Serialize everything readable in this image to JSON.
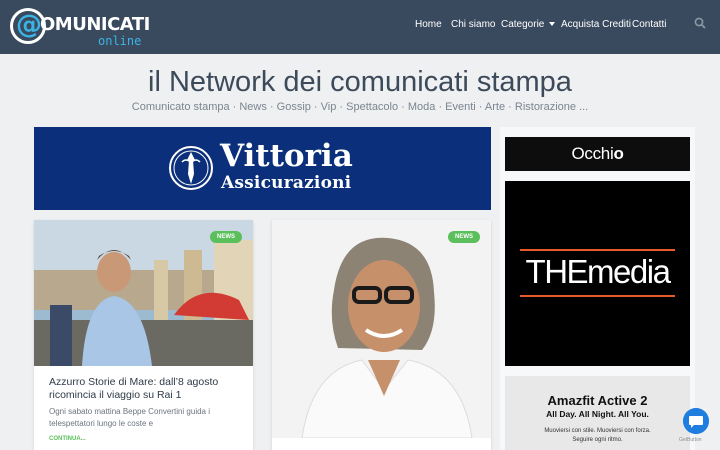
{
  "header": {
    "logo_at": "@",
    "logo_text": "OMUNICATI",
    "logo_sub": "online",
    "nav": [
      "Home",
      "Chi siamo",
      "Categorie",
      "Acquista Crediti",
      "Contatti"
    ]
  },
  "site": {
    "title": "il Network dei comunicati stampa",
    "subtitle": "Comunicato stampa · News · Gossip · Vip · Spettacolo · Moda · Eventi · Arte · Ristorazione ..."
  },
  "banner": {
    "title": "Vittoria",
    "subtitle": "Assicurazioni"
  },
  "cards": [
    {
      "badge": "NEWS",
      "title": "Azzurro Storie di Mare: dall’8 agosto ricomincia il viaggio su Rai 1",
      "excerpt": "Ogni sabato mattina Beppe Convertini guida i telespettatori lungo le coste e",
      "more": "CONTINUA..."
    },
    {
      "badge": "NEWS"
    }
  ],
  "sidebar": {
    "occhio_a": "Occhi",
    "occhio_b": "o",
    "themedia": "THEmedia",
    "amazfit_title": "Amazfit Active 2",
    "amazfit_tag": "All Day. All Night. All You.",
    "amazfit_desc_1": "Muoviersi con stile. Muoviersi con forza.",
    "amazfit_desc_2": "Seguire ogni ritmo."
  },
  "chat": {
    "label": "GetButton"
  },
  "colors": {
    "header_bg": "#3a4a5e",
    "accent_blue": "#3bb3e3",
    "banner_blue": "#0b2f7a",
    "news_green": "#5bbf5b",
    "themedia_orange": "#e8592a"
  }
}
